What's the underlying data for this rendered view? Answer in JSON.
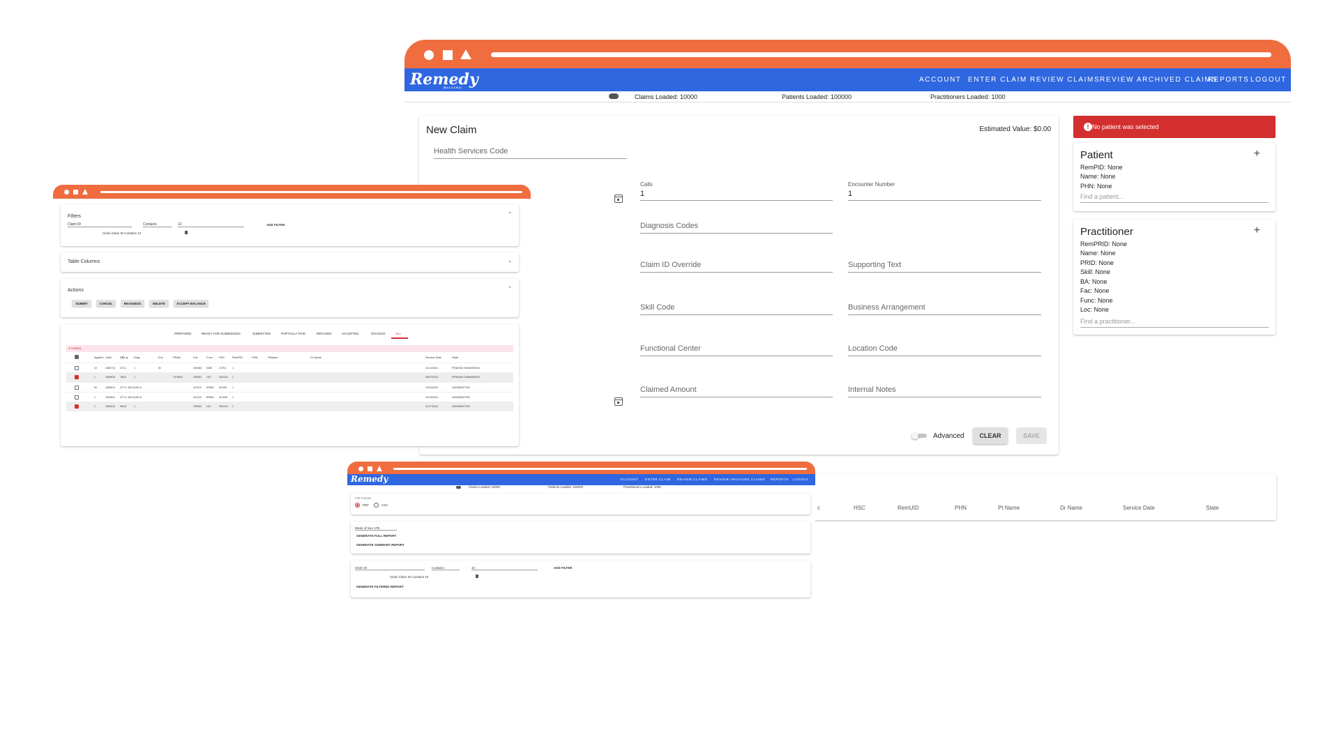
{
  "brand": {
    "name": "Remedy",
    "tagline": "BILLING",
    "accent": "#ef6d3f",
    "nav_color": "#2f67e0",
    "error_color": "#d32f2f"
  },
  "main_window": {
    "nav": [
      "ACCOUNT",
      "ENTER CLAIM",
      "REVIEW CLAIMS",
      "REVIEW ARCHIVED CLAIMS",
      "REPORTS",
      "LOGOUT"
    ],
    "status": {
      "claims": "Claims Loaded: 10000",
      "patients": "Patients Loaded: 100000",
      "practitioners": "Practitioners Loaded: 1000"
    },
    "claim": {
      "title": "New Claim",
      "estimated": "Estimated Value: $0.00",
      "health_services_code": "Health Services Code",
      "calls_label": "Calls",
      "calls_value": "1",
      "encounter_label": "Encounter Number",
      "encounter_value": "1",
      "diagnosis_codes": "Diagnosis Codes",
      "claim_id_override": "Claim ID Override",
      "supporting_text": "Supporting Text",
      "skill_code": "Skill Code",
      "business_arrangement": "Business Arrangement",
      "functional_center": "Functional Center",
      "location_code": "Location Code",
      "claimed_amount": "Claimed Amount",
      "internal_notes": "Internal Notes",
      "advanced": "Advanced",
      "clear": "CLEAR",
      "save": "SAVE"
    },
    "alert": "No patient was selected",
    "patient": {
      "title": "Patient",
      "lines": [
        "RemPID: None",
        "Name: None",
        "PHN: None"
      ],
      "find": "Find a patient..."
    },
    "practitioner": {
      "title": "Practitioner",
      "lines": [
        "RemPRID: None",
        "Name: None",
        "PRID: None",
        "Skill: None",
        "BA: None",
        "Fac: None",
        "Func: None",
        "Loc: None"
      ],
      "find": "Find a practitioner..."
    },
    "bg_table_headers": [
      "c",
      "HSC",
      "RemUID",
      "PHN",
      "Pt Name",
      "Dr Name",
      "Service Date",
      "State"
    ]
  },
  "review_window": {
    "filters": {
      "title": "Filters",
      "field": "Claim ID",
      "op": "Contains",
      "value": "12",
      "add": "ADD FILTER",
      "chip": "Claim Claim ID Contains 12"
    },
    "table_columns": "Table Columns",
    "actions": {
      "title": "Actions",
      "buttons": [
        "SUBMIT",
        "CANCEL",
        "REASSESS",
        "DELETE",
        "ACCEPT BALANCE"
      ]
    },
    "tabs": [
      "PREPARED",
      "READY FOR SUBMISSION",
      "SUBMITTED",
      "PARTIALLY PAID",
      "REFUSED",
      "ACCEPTED",
      "ON HOLD",
      "ALL"
    ],
    "selected": "2 rows(s)",
    "headers": [
      "Applied",
      "Calls",
      "CID ▲",
      "Diag",
      "Enc",
      "PRstb",
      "Fac",
      "Func",
      "HSC",
      "RemPID",
      "PHN",
      "PtName",
      "Dr Name",
      "Service Date",
      "State"
    ],
    "rows": [
      {
        "checked": false,
        "cells": [
          "10",
          "1800715",
          "274.1",
          "1",
          "8V",
          "",
          "209366",
          "0489",
          "19 RU",
          "1",
          "",
          "",
          "",
          "11/14/2024",
          "PENDING SUBMISSION"
        ]
      },
      {
        "checked": true,
        "cells": [
          "1",
          "1800615",
          "785.6",
          "1",
          "",
          "7975902",
          "209952",
          "LKC",
          "03U134",
          "1",
          "",
          "",
          "",
          "06/07/2024",
          "PENDING SUBMISSION"
        ]
      },
      {
        "checked": false,
        "cells": [
          "60",
          "1800612",
          "477.9, 493.9, 491.8",
          "1",
          "",
          "",
          "421120",
          "ERWH",
          "08.09E",
          "1",
          "",
          "",
          "",
          "10/24/2024",
          "UNSUBMITTED"
        ]
      },
      {
        "checked": false,
        "cells": [
          "1",
          "1800612",
          "477.9, 493.9, 491.8",
          "1",
          "",
          "",
          "421120",
          "ERWH",
          "03.0NH",
          "1",
          "",
          "",
          "",
          "10/19/2024",
          "UNSUBMITTED"
        ]
      },
      {
        "checked": true,
        "cells": [
          "1",
          "1800012",
          "595.8",
          "1",
          "",
          "",
          "209952",
          "LKC",
          "03U134",
          "1",
          "",
          "",
          "",
          "11/17/2024",
          "UNSUBMITTED"
        ]
      }
    ]
  },
  "reports_window": {
    "nav": [
      "ACCOUNT",
      "ENTER CLAIM",
      "REVIEW CLAIMS",
      "REVIEW ARCHIVED CLAIMS",
      "REPORTS",
      "LOGOUT"
    ],
    "status": {
      "claims": "Claims Loaded: 10000",
      "patients": "Patients Loaded: 100000",
      "practitioners": "Practitioners Loaded: 1000"
    },
    "file_format": "File Format",
    "formats": [
      "PDF",
      "CSV"
    ],
    "week": "Week of Nov 17th",
    "full_report": "GENERATE FULL REPORT",
    "summary_report": "GENERATE SUMMARY REPORT",
    "filter": {
      "field": "Claim ID",
      "op": "Contains",
      "value": "10",
      "add": "ADD FILTER",
      "chip": "Claim Claim ID Contains 10"
    },
    "filtered_report": "GENERATE FILTERED REPORT"
  }
}
